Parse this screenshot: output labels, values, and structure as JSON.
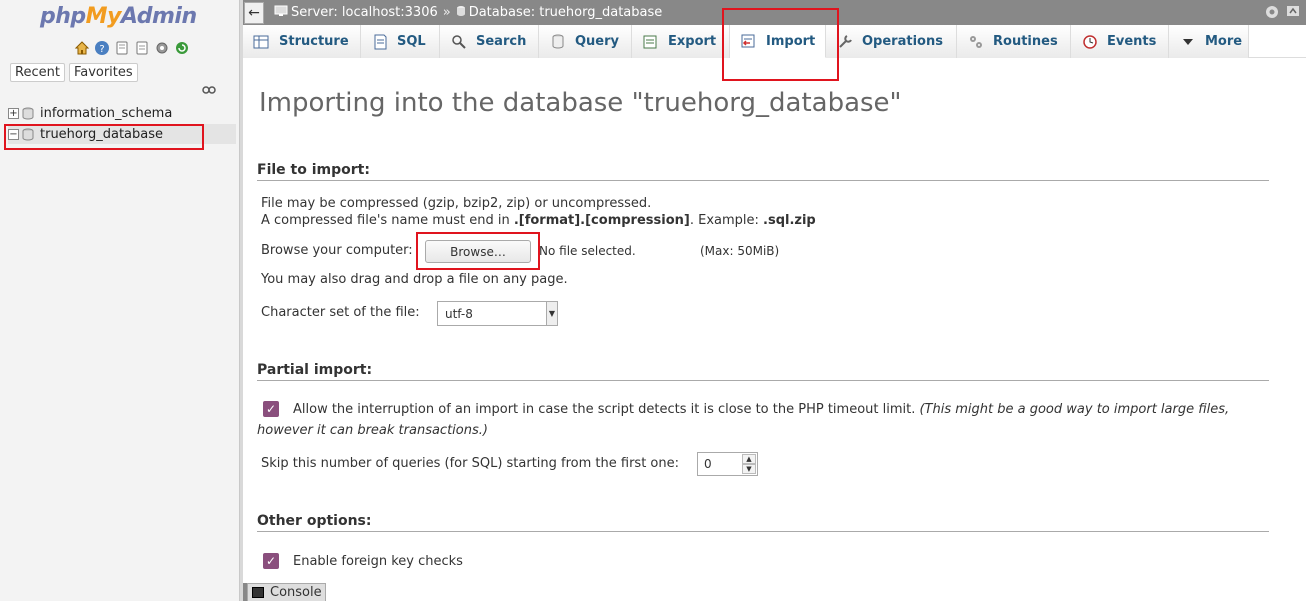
{
  "nav": {
    "logo": {
      "php": "php",
      "my": "My",
      "admin": "Admin"
    },
    "tabs": [
      "Recent",
      "Favorites"
    ],
    "databases": [
      {
        "name": "information_schema",
        "expander": "+"
      },
      {
        "name": "truehorg_database",
        "expander": "−"
      }
    ]
  },
  "breadcrumb": {
    "server": "Server: localhost:3306",
    "separator": "»",
    "database": "Database: truehorg_database"
  },
  "tabs": [
    {
      "label": "Structure",
      "icon": "structure-icon"
    },
    {
      "label": "SQL",
      "icon": "sql-icon"
    },
    {
      "label": "Search",
      "icon": "search-icon"
    },
    {
      "label": "Query",
      "icon": "query-icon"
    },
    {
      "label": "Export",
      "icon": "export-icon"
    },
    {
      "label": "Import",
      "icon": "import-icon",
      "active": true
    },
    {
      "label": "Operations",
      "icon": "wrench-icon"
    },
    {
      "label": "Routines",
      "icon": "routines-icon"
    },
    {
      "label": "Events",
      "icon": "clock-icon"
    },
    {
      "label": "More",
      "icon": "triangle-down-icon"
    }
  ],
  "main": {
    "title": "Importing into the database \"truehorg_database\"",
    "file_section": {
      "heading": "File to import:",
      "line1": "File may be compressed (gzip, bzip2, zip) or uncompressed.",
      "line2_prefix": "A compressed file's name must end in ",
      "line2_format": ".[format].[compression]",
      "line2_mid": ". Example: ",
      "line2_example": ".sql.zip",
      "browse_label": "Browse your computer:",
      "browse_button": "Browse…",
      "file_status": "No file selected.",
      "max_size": "(Max: 50MiB)",
      "drag_note": "You may also drag and drop a file on any page.",
      "charset_label": "Character set of the file:",
      "charset_value": "utf-8"
    },
    "partial_section": {
      "heading": "Partial import:",
      "allow_interrupt_label": "Allow the interruption of an import in case the script detects it is close to the PHP timeout limit.",
      "allow_interrupt_note_1": "(This might be a good way to import large files,",
      "allow_interrupt_note_2": "however it can break transactions.)",
      "allow_interrupt_checked": true,
      "skip_label": "Skip this number of queries (for SQL) starting from the first one:",
      "skip_value": "0"
    },
    "other_section": {
      "heading": "Other options:",
      "fk_label": "Enable foreign key checks",
      "fk_checked": true
    }
  },
  "console": {
    "label": "Console"
  },
  "colors": {
    "accent": "#235a81",
    "highlight": "#e0141e",
    "checkbox": "#8a4f7d",
    "topbar": "#888888"
  }
}
